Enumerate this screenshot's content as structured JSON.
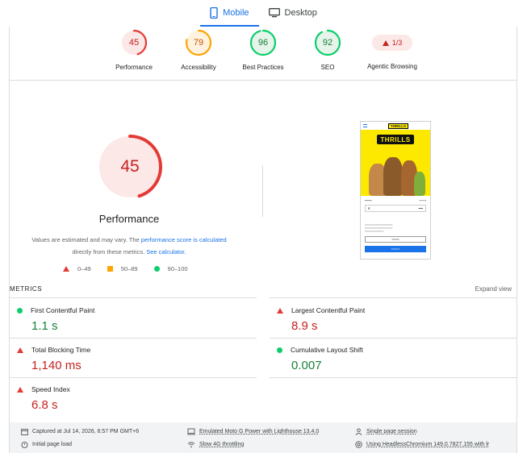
{
  "tabs": [
    {
      "label": "Mobile",
      "icon": "phone-icon",
      "active": true
    },
    {
      "label": "Desktop",
      "icon": "monitor-icon",
      "active": false
    }
  ],
  "summary": {
    "performance": {
      "score": "45",
      "label": "Performance",
      "color": "#c5221f",
      "fraction": 0.45
    },
    "accessibility": {
      "score": "79",
      "label": "Accessibility",
      "color": "#c25100",
      "fraction": 0.79
    },
    "best_practices": {
      "score": "96",
      "label": "Best Practices",
      "color": "#188038",
      "fraction": 0.96
    },
    "seo": {
      "score": "92",
      "label": "SEO",
      "color": "#188038",
      "fraction": 0.92
    },
    "agentic": {
      "value": "1/3",
      "label": "Agentic Browsing"
    }
  },
  "main": {
    "score": "45",
    "score_fraction": 0.45,
    "title": "Performance",
    "note_prefix": "Values are estimated and may vary. The ",
    "note_link1": "performance score is calculated",
    "note_middle": " directly from these metrics. ",
    "note_link2": "See calculator.",
    "legend": [
      {
        "range": "0–49",
        "shape": "triangle",
        "color": "#e53935"
      },
      {
        "range": "50–89",
        "shape": "square",
        "color": "#ffa400"
      },
      {
        "range": "90–100",
        "shape": "circle",
        "color": "#0cce6b"
      }
    ]
  },
  "phone_preview": {
    "logo": "THRILLS"
  },
  "metrics": {
    "header": "METRICS",
    "expand": "Expand view",
    "items": [
      {
        "name": "First Contentful Paint",
        "value": "1.1 s",
        "status": "good"
      },
      {
        "name": "Largest Contentful Paint",
        "value": "8.9 s",
        "status": "poor"
      },
      {
        "name": "Total Blocking Time",
        "value": "1,140 ms",
        "status": "poor"
      },
      {
        "name": "Cumulative Layout Shift",
        "value": "0.007",
        "status": "good"
      },
      {
        "name": "Speed Index",
        "value": "6.8 s",
        "status": "poor"
      }
    ]
  },
  "footer": {
    "captured": "Captured at Jul 14, 2026, 6:57 PM GMT+6",
    "load": "Initial page load",
    "device": "Emulated Moto G Power with Lighthouse 13.4.0",
    "throttle": "Slow 4G throttling",
    "session": "Single page session",
    "browser": "Using HeadlessChromium 149.0.7827.155 with lr"
  }
}
